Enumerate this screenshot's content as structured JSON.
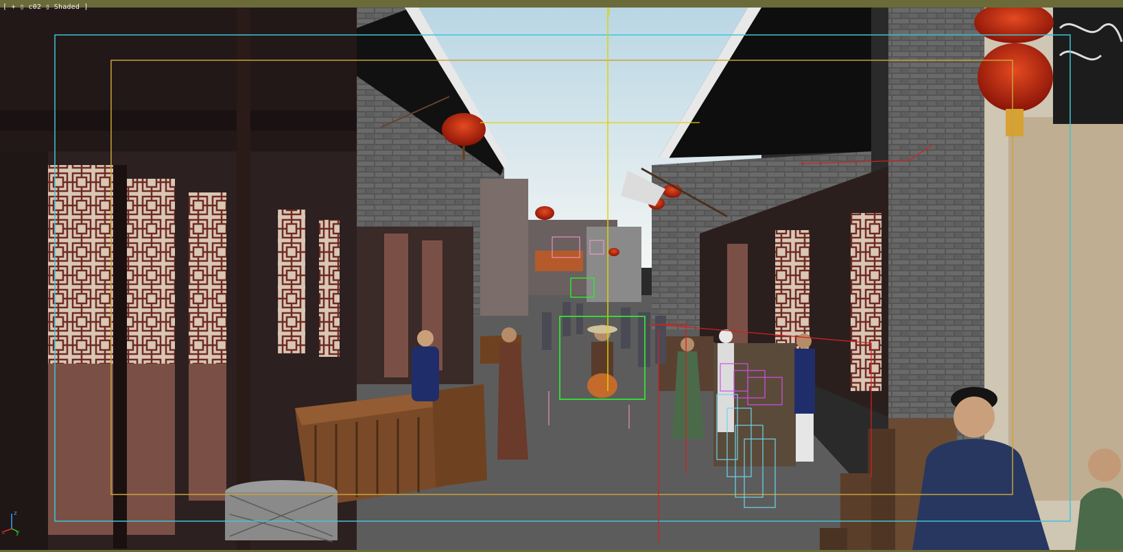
{
  "viewport": {
    "label_bracket_open": "[",
    "label_plus": "+",
    "label_box": "▯",
    "camera_name": "c02",
    "label_box2": "▯",
    "shading_mode": "Shaded",
    "label_bracket_close": "]"
  },
  "axis_gizmo": {
    "x": "x",
    "y": "y",
    "z": "z"
  },
  "colors": {
    "safe_frame_outer": "#3fc6d6",
    "safe_frame_inner": "#c9a23a",
    "crosshair": "#e0d200",
    "selection_green": "#32e632",
    "selection_red": "#d42020",
    "selection_cyan": "#6fd6ea",
    "selection_magenta": "#d050e6",
    "lantern_red": "#c42818",
    "sky": "#d7e6ee",
    "ground": "#595959"
  }
}
